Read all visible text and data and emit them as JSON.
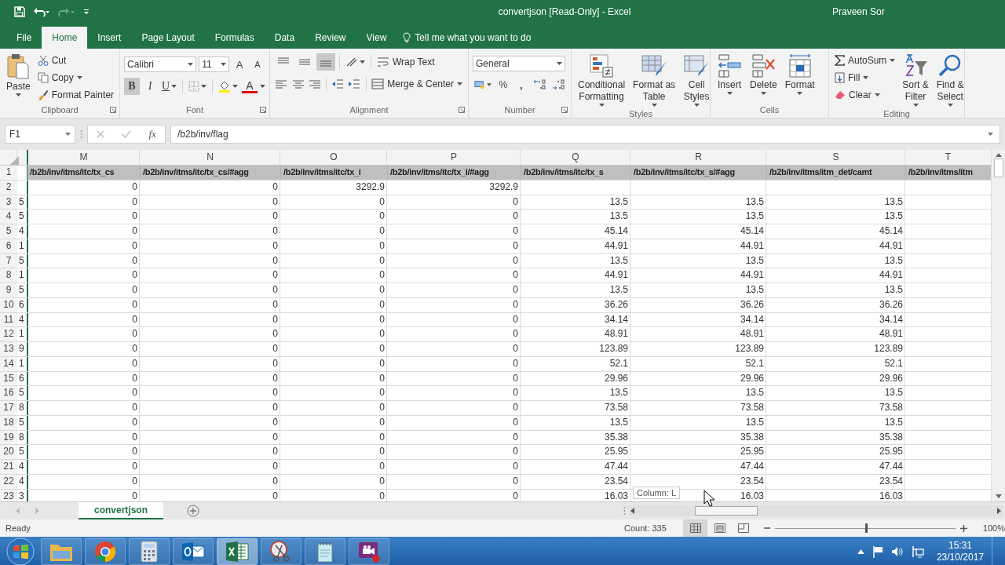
{
  "title_bar": {
    "title": "convertjson  [Read-Only]  -  Excel",
    "user": "Praveen Sor"
  },
  "tabs": [
    {
      "label": "File",
      "selected": false
    },
    {
      "label": "Home",
      "selected": true
    },
    {
      "label": "Insert",
      "selected": false
    },
    {
      "label": "Page Layout",
      "selected": false
    },
    {
      "label": "Formulas",
      "selected": false
    },
    {
      "label": "Data",
      "selected": false
    },
    {
      "label": "Review",
      "selected": false
    },
    {
      "label": "View",
      "selected": false
    }
  ],
  "tell_me": "Tell me what you want to do",
  "ribbon": {
    "clipboard": {
      "label": "Clipboard",
      "paste": "Paste",
      "cut": "Cut",
      "copy": "Copy",
      "format_painter": "Format Painter"
    },
    "font": {
      "label": "Font",
      "font_name": "Calibri",
      "font_size": "11",
      "grow": "A",
      "shrink": "A",
      "bold": {
        "text": "B",
        "on": true
      },
      "italic": {
        "text": "I",
        "on": false
      },
      "underline": {
        "text": "U",
        "on": false
      },
      "font_color": "A"
    },
    "alignment": {
      "label": "Alignment",
      "vertical": [
        {
          "kind": "top",
          "on": false
        },
        {
          "kind": "middle",
          "on": false
        },
        {
          "kind": "bottom",
          "on": true
        }
      ],
      "horizontal": [
        {
          "kind": "left",
          "on": false
        },
        {
          "kind": "center",
          "on": false
        },
        {
          "kind": "right",
          "on": false
        }
      ],
      "wrap_text": "Wrap Text",
      "merge_center": "Merge & Center"
    },
    "number": {
      "label": "Number",
      "format": "General",
      "percent": "%",
      "comma": ","
    },
    "styles": {
      "label": "Styles",
      "commands": [
        {
          "lines": [
            "Conditional",
            "Formatting"
          ]
        },
        {
          "lines": [
            "Format as",
            "Table"
          ]
        },
        {
          "lines": [
            "Cell",
            "Styles"
          ]
        }
      ]
    },
    "cells": {
      "label": "Cells",
      "commands": [
        {
          "lines": [
            "Insert"
          ]
        },
        {
          "lines": [
            "Delete"
          ]
        },
        {
          "lines": [
            "Format"
          ]
        }
      ]
    },
    "editing": {
      "label": "Editing",
      "autosum": "AutoSum",
      "fill": "Fill",
      "clear": "Clear",
      "commands": [
        {
          "lines": [
            "Sort &",
            "Filter"
          ]
        },
        {
          "lines": [
            "Find &",
            "Select"
          ]
        }
      ]
    }
  },
  "formula_bar": {
    "name_box": "F1",
    "function_label": "fx",
    "formula": "/b2b/inv/flag"
  },
  "sheet": {
    "columns": [
      "M",
      "N",
      "O",
      "P",
      "Q",
      "R",
      "S",
      "T"
    ],
    "header_row": {
      "number": "1",
      "cells": [
        "/b2b/inv/itms/itc/tx_cs",
        "/b2b/inv/itms/itc/tx_cs/#agg",
        "/b2b/inv/itms/itc/tx_i",
        "/b2b/inv/itms/itc/tx_i/#agg",
        "/b2b/inv/itms/itc/tx_s",
        "/b2b/inv/itms/itc/tx_s/#agg",
        "/b2b/inv/itms/itm_det/camt",
        "/b2b/inv/itms/itm"
      ]
    },
    "rows": [
      {
        "number": "2",
        "cells": [
          "0",
          "0",
          "3292.9",
          "3292.9"
        ]
      },
      {
        "number": "3",
        "column_L": "5",
        "cells": [
          "0",
          "0",
          "0",
          "0",
          "13.5",
          "13.5",
          "13.5"
        ]
      },
      {
        "number": "4",
        "column_L": "5",
        "cells": [
          "0",
          "0",
          "0",
          "0",
          "13.5",
          "13.5",
          "13.5"
        ]
      },
      {
        "number": "5",
        "column_L": "4",
        "cells": [
          "0",
          "0",
          "0",
          "0",
          "45.14",
          "45.14",
          "45.14"
        ]
      },
      {
        "number": "6",
        "column_L": "1",
        "cells": [
          "0",
          "0",
          "0",
          "0",
          "44.91",
          "44.91",
          "44.91"
        ]
      },
      {
        "number": "7",
        "column_L": "5",
        "cells": [
          "0",
          "0",
          "0",
          "0",
          "13.5",
          "13.5",
          "13.5"
        ]
      },
      {
        "number": "8",
        "column_L": "1",
        "cells": [
          "0",
          "0",
          "0",
          "0",
          "44.91",
          "44.91",
          "44.91"
        ]
      },
      {
        "number": "9",
        "column_L": "5",
        "cells": [
          "0",
          "0",
          "0",
          "0",
          "13.5",
          "13.5",
          "13.5"
        ]
      },
      {
        "number": "10",
        "column_L": "6",
        "cells": [
          "0",
          "0",
          "0",
          "0",
          "36.26",
          "36.26",
          "36.26"
        ]
      },
      {
        "number": "11",
        "column_L": "4",
        "cells": [
          "0",
          "0",
          "0",
          "0",
          "34.14",
          "34.14",
          "34.14"
        ]
      },
      {
        "number": "12",
        "column_L": "1",
        "cells": [
          "0",
          "0",
          "0",
          "0",
          "48.91",
          "48.91",
          "48.91"
        ]
      },
      {
        "number": "13",
        "column_L": "9",
        "cells": [
          "0",
          "0",
          "0",
          "0",
          "123.89",
          "123.89",
          "123.89"
        ]
      },
      {
        "number": "14",
        "column_L": "1",
        "cells": [
          "0",
          "0",
          "0",
          "0",
          "52.1",
          "52.1",
          "52.1"
        ]
      },
      {
        "number": "15",
        "column_L": "6",
        "cells": [
          "0",
          "0",
          "0",
          "0",
          "29.96",
          "29.96",
          "29.96"
        ]
      },
      {
        "number": "16",
        "column_L": "5",
        "cells": [
          "0",
          "0",
          "0",
          "0",
          "13.5",
          "13.5",
          "13.5"
        ]
      },
      {
        "number": "17",
        "column_L": "8",
        "cells": [
          "0",
          "0",
          "0",
          "0",
          "73.58",
          "73.58",
          "73.58"
        ]
      },
      {
        "number": "18",
        "column_L": "5",
        "cells": [
          "0",
          "0",
          "0",
          "0",
          "13.5",
          "13.5",
          "13.5"
        ]
      },
      {
        "number": "19",
        "column_L": "8",
        "cells": [
          "0",
          "0",
          "0",
          "0",
          "35.38",
          "35.38",
          "35.38"
        ]
      },
      {
        "number": "20",
        "column_L": "5",
        "cells": [
          "0",
          "0",
          "0",
          "0",
          "25.95",
          "25.95",
          "25.95"
        ]
      },
      {
        "number": "21",
        "column_L": "4",
        "cells": [
          "0",
          "0",
          "0",
          "0",
          "47.44",
          "47.44",
          "47.44"
        ]
      },
      {
        "number": "22",
        "column_L": "4",
        "cells": [
          "0",
          "0",
          "0",
          "0",
          "23.54",
          "23.54",
          "23.54"
        ]
      },
      {
        "number": "23",
        "column_L": "3",
        "cells": [
          "0",
          "0",
          "0",
          "0",
          "16.03",
          "16.03",
          "16.03"
        ]
      }
    ],
    "tooltip": "Column: L"
  },
  "sheet_tabs": [
    {
      "label": "convertjson",
      "selected": true
    }
  ],
  "status_bar": {
    "status": "Ready",
    "count": "Count: 335",
    "views": [
      {
        "kind": "normal",
        "selected": true
      },
      {
        "kind": "page_layout",
        "selected": false
      },
      {
        "kind": "page_break",
        "selected": false
      }
    ],
    "zoom": {
      "level": 0.5,
      "reading": "100%"
    }
  },
  "taskbar": {
    "apps": [
      {
        "kind": "folder",
        "active": false
      },
      {
        "kind": "browser",
        "active": false
      },
      {
        "kind": "calculator",
        "active": false
      },
      {
        "kind": "mail",
        "active": false
      },
      {
        "kind": "spreadsheet",
        "active": true
      },
      {
        "kind": "scissors",
        "active": false
      },
      {
        "kind": "notepad",
        "active": false
      },
      {
        "kind": "video",
        "active": false
      }
    ],
    "time": "15:31",
    "date": "23/10/2017"
  }
}
